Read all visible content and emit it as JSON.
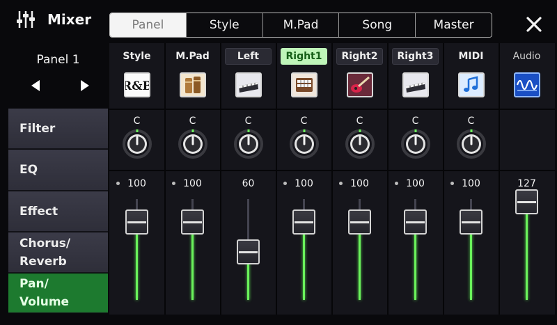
{
  "app": {
    "title": "Mixer"
  },
  "tabs": [
    {
      "label": "Panel",
      "active": true
    },
    {
      "label": "Style",
      "active": false
    },
    {
      "label": "M.Pad",
      "active": false
    },
    {
      "label": "Song",
      "active": false
    },
    {
      "label": "Master",
      "active": false
    }
  ],
  "panel_select": {
    "name": "Panel 1"
  },
  "menu": [
    {
      "label": "Filter",
      "active": false
    },
    {
      "label": "EQ",
      "active": false
    },
    {
      "label": "Effect",
      "active": false
    },
    {
      "label": "Chorus/\nReverb",
      "active": false
    },
    {
      "label": "Pan/\nVolume",
      "active": true
    }
  ],
  "channels": [
    {
      "label": "Style",
      "icon": "rnb-style-icon",
      "pan": "C",
      "volume": "100",
      "level": 100,
      "max": 127
    },
    {
      "label": "M.Pad",
      "icon": "djembe-icon",
      "pan": "C",
      "volume": "100",
      "level": 100,
      "max": 127
    },
    {
      "label": "Left",
      "icon": "keyboard-icon",
      "pan": "C",
      "volume": "60",
      "level": 60,
      "max": 127
    },
    {
      "label": "Right1",
      "icon": "organ-icon",
      "pan": "C",
      "volume": "100",
      "level": 100,
      "max": 127
    },
    {
      "label": "Right2",
      "icon": "electric-guitar-icon",
      "pan": "C",
      "volume": "100",
      "level": 100,
      "max": 127
    },
    {
      "label": "Right3",
      "icon": "keyboard-icon",
      "pan": "C",
      "volume": "100",
      "level": 100,
      "max": 127
    },
    {
      "label": "MIDI",
      "icon": "music-note-icon",
      "pan": "C",
      "volume": "100",
      "level": 100,
      "max": 127
    },
    {
      "label": "Audio",
      "icon": "waveform-icon",
      "pan": "",
      "volume": "127",
      "level": 127,
      "max": 127
    }
  ],
  "colors": {
    "accent_green": "#6af25b",
    "active_menu": "#1d7a2f",
    "active_label": "#bff5b9"
  }
}
